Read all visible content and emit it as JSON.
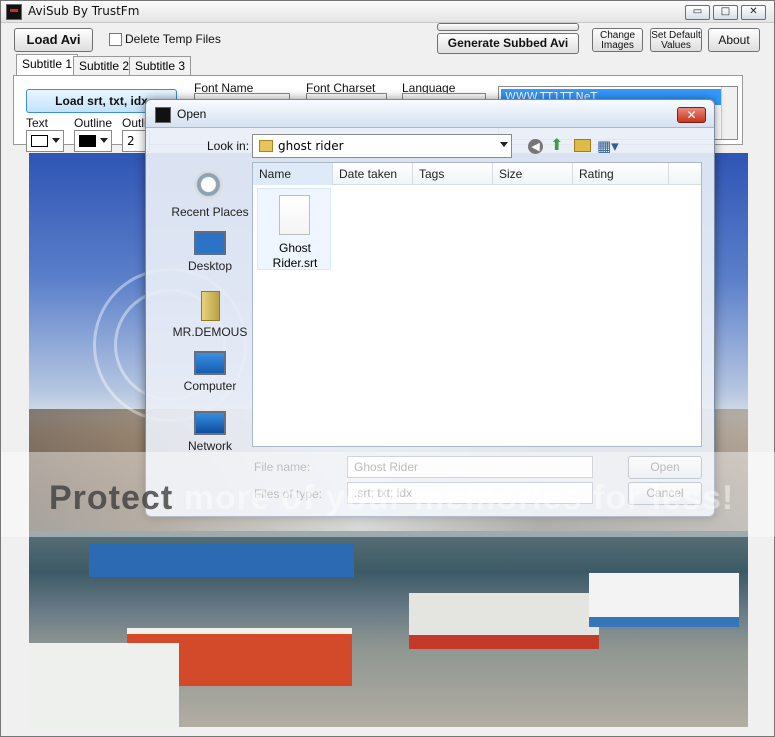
{
  "app": {
    "title": "AviSub By TrustFm",
    "buttons": {
      "load_avi": "Load Avi",
      "delete_temp": "Delete Temp Files",
      "generate": "Generate Subbed Avi",
      "change_images": "Change\nImages",
      "set_defaults": "Set Default\nValues",
      "about": "About"
    },
    "window_controls": {
      "minimize": "▭",
      "maximize": "□",
      "close": "✕"
    },
    "tabs": [
      "Subtitle 1",
      "Subtitle 2",
      "Subtitle 3"
    ],
    "subtitle_panel": {
      "load_button": "Load srt, txt, idx",
      "font_name_label": "Font Name",
      "font_charset_label": "Font Charset",
      "language_label": "Language",
      "text_label": "Text",
      "outline_label": "Outline",
      "outline_label_2": "Outlin",
      "outline_value": "2",
      "selected_language": "WWW.TT1TT.NeT"
    }
  },
  "dialog": {
    "title": "Open",
    "look_in_label": "Look in:",
    "look_in_value": "ghost rider",
    "nav_items": [
      "Recent Places",
      "Desktop",
      "MR.DEMOUS",
      "Computer",
      "Network"
    ],
    "columns": [
      "Name",
      "Date taken",
      "Tags",
      "Size",
      "Rating"
    ],
    "file": {
      "name": "Ghost Rider.srt"
    },
    "file_name_label": "File name:",
    "file_name_value": "Ghost Rider",
    "file_type_label": "Files of type:",
    "file_type_value": ".srt; txt; idx",
    "open_button": "Open",
    "cancel_button": "Cancel"
  },
  "watermark": {
    "text_dark": "Protect",
    "text_light": " more of your memories for less!"
  },
  "colors": {
    "selection": "#3399ff",
    "title_bar": "#dfe7f2"
  }
}
